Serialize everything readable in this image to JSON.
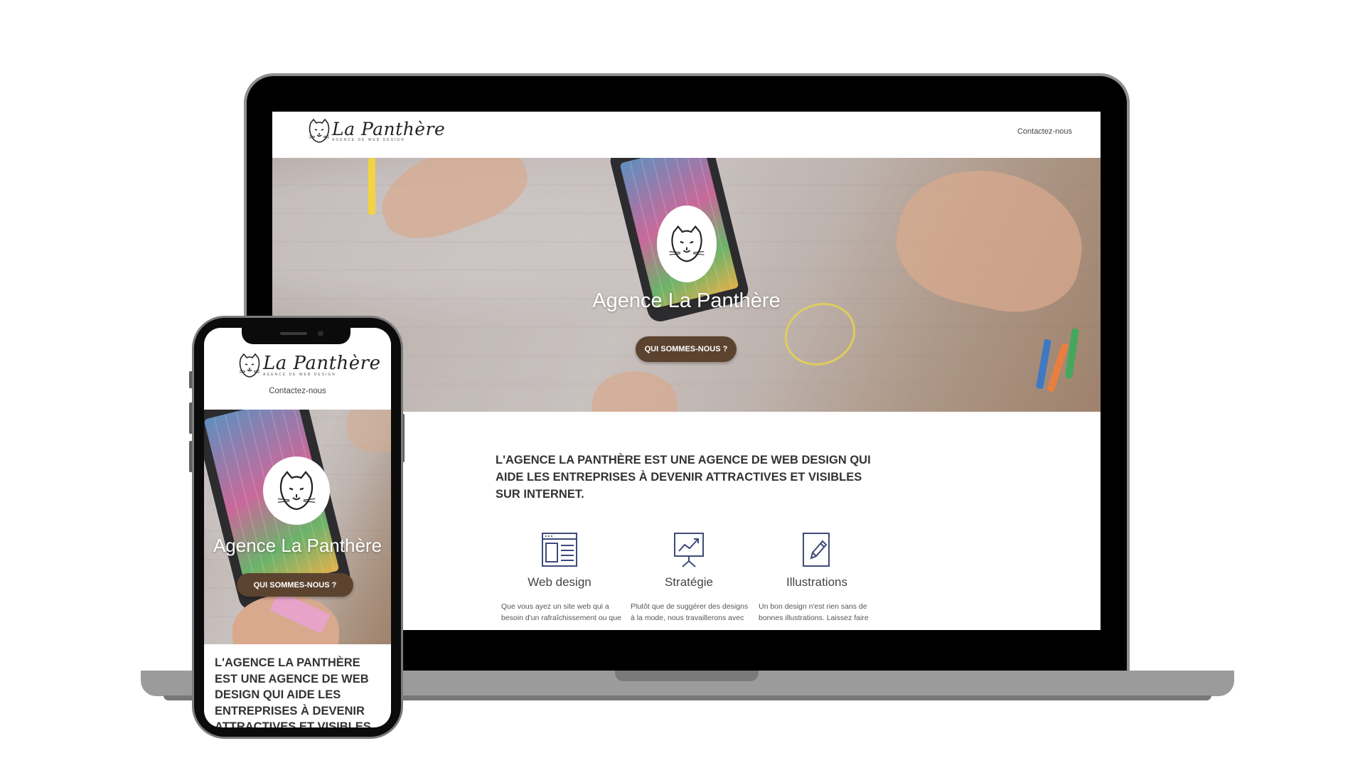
{
  "brand": {
    "name": "La Panthère",
    "tagline": "AGENCE DE WEB DESIGN"
  },
  "nav": {
    "contact_label": "Contactez-nous"
  },
  "hero": {
    "title": "Agence La Panthère",
    "button_label": "QUI SOMMES-NOUS ?"
  },
  "intro": {
    "text": "L'AGENCE LA PANTHÈRE EST UNE AGENCE DE WEB DESIGN QUI AIDE LES ENTREPRISES À DEVENIR ATTRACTIVES ET VISIBLES SUR INTERNET."
  },
  "services": [
    {
      "icon": "web-design-icon",
      "title": "Web design",
      "desc": "Que vous ayez un site web qui a besoin d'un rafraîchissement ou que"
    },
    {
      "icon": "strategy-icon",
      "title": "Stratégie",
      "desc": "Plutôt que de suggérer des designs à la mode, nous travaillerons avec"
    },
    {
      "icon": "illustration-icon",
      "title": "Illustrations",
      "desc": "Un bon design n'est rien sans de bonnes illustrations. Laissez faire"
    }
  ],
  "colors": {
    "button_bg": "#5b4330",
    "icon_stroke": "#3e4a7a",
    "text_dark": "#333333"
  }
}
